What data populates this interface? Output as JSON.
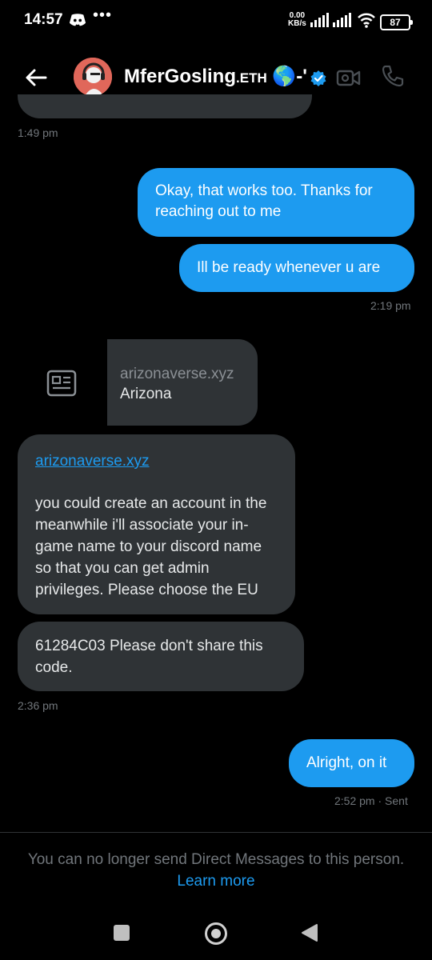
{
  "status_bar": {
    "time": "14:57",
    "more": "•••",
    "speed_value": "0.00",
    "speed_unit": "KB/s",
    "battery": "87"
  },
  "header": {
    "name": "MferGosling",
    "suffix": ".ETH",
    "emoji": "🌎-'"
  },
  "messages": {
    "ts1": "1:49 pm",
    "out1": "Okay, that works too. Thanks for reaching out to me",
    "out2": "Ill be ready whenever u are",
    "ts2": "2:19 pm",
    "card_domain": "arizonaverse.xyz",
    "card_title": "Arizona",
    "in1_link": "arizonaverse.xyz",
    "in1_text": "you could create an account in the meanwhile i'll associate your in-game name to your discord name so that you can get admin privileges. Please choose the EU",
    "in2_text": "61284C03 Please don't share this code.",
    "ts3": "2:36 pm",
    "out3": "Alright, on it",
    "ts4": "2:52 pm · Sent"
  },
  "footer": {
    "notice": "You can no longer send Direct Messages to this person.",
    "learn_more": "Learn more"
  },
  "colors": {
    "accent": "#1d9bf0",
    "bubble_in": "#2f3336",
    "background": "#000000"
  }
}
